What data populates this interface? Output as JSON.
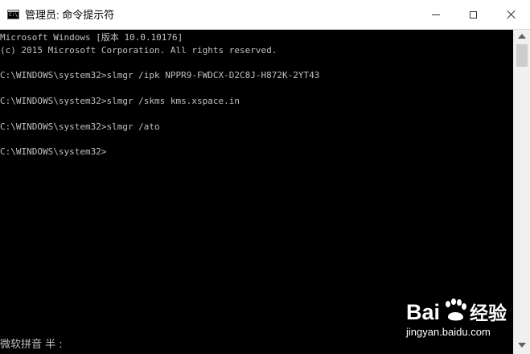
{
  "window": {
    "title": "管理员: 命令提示符",
    "icon": "cmd-icon",
    "icon_text": "C:\\"
  },
  "controls": {
    "minimize_icon": "minimize-icon",
    "maximize_icon": "maximize-icon",
    "close_icon": "close-icon"
  },
  "console": {
    "lines": [
      "Microsoft Windows [版本 10.0.10176]",
      "(c) 2015 Microsoft Corporation. All rights reserved.",
      "",
      "C:\\WINDOWS\\system32>slmgr /ipk NPPR9-FWDCX-D2C8J-H872K-2YT43",
      "",
      "C:\\WINDOWS\\system32>slmgr /skms kms.xspace.in",
      "",
      "C:\\WINDOWS\\system32>slmgr /ato",
      "",
      "C:\\WINDOWS\\system32>"
    ],
    "text_color": "#c0c0c0",
    "background": "#000000"
  },
  "ime_status": "微软拼音 半 :",
  "watermark": {
    "logo_text": "Bai",
    "logo_text_2": "经验",
    "url": "jingyan.baidu.com"
  }
}
